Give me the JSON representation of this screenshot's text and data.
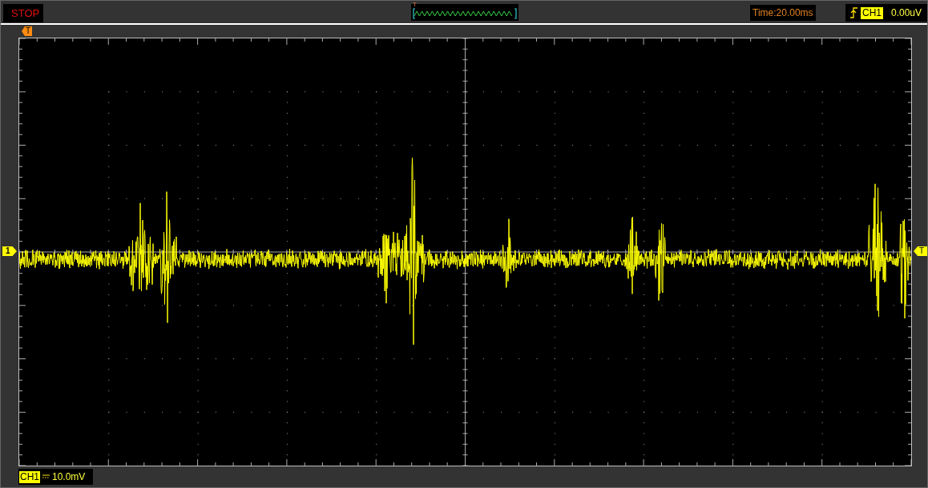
{
  "run_status": "STOP",
  "overview": {
    "trigger_marker": "T"
  },
  "timebase": "Time:20.00ms",
  "trigger": {
    "channel": "CH1",
    "level": "0.00uV"
  },
  "screen": {
    "trigger_position_marker": "T",
    "channel_marker": "1",
    "trigger_level_marker": "T"
  },
  "channel_info": {
    "channel": "CH1",
    "scale": "10.0mV"
  }
}
